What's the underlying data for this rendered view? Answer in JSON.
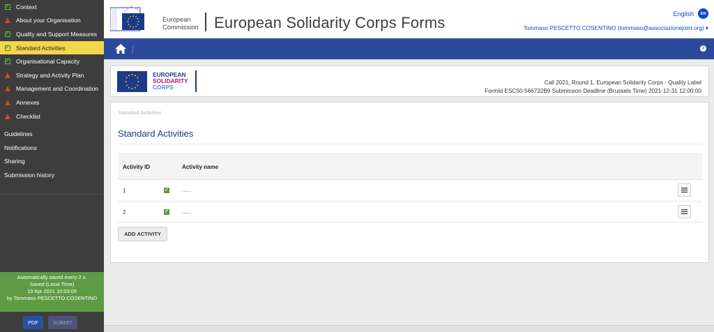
{
  "sidebar": {
    "sections": [
      {
        "label": "Context",
        "status": "check",
        "active": false
      },
      {
        "label": "About your Organisation",
        "status": "warn",
        "active": false
      },
      {
        "label": "Quality and Support Measures",
        "status": "check",
        "active": false
      },
      {
        "label": "Standard Activities",
        "status": "check",
        "active": true
      },
      {
        "label": "Organisational Capacity",
        "status": "check",
        "active": false
      },
      {
        "label": "Strategy and Activity Plan",
        "status": "warn",
        "active": false
      },
      {
        "label": "Management and Coordination",
        "status": "warn",
        "active": false
      },
      {
        "label": "Annexes",
        "status": "warn",
        "active": false
      },
      {
        "label": "Checklist",
        "status": "warn",
        "active": false
      }
    ],
    "links": [
      "Guidelines",
      "Notifications",
      "Sharing",
      "Submission history"
    ],
    "autosave": {
      "line1": "Automatically saved every 2 s.",
      "line2": "Saved (Local Time)",
      "line3": "19 Apr 2021 10:03:09",
      "line4": "by Tommaso PESCETTO COSENTINO"
    },
    "pdf_label": "PDF",
    "submit_label": "SUBMIT"
  },
  "header": {
    "ec_line1": "European",
    "ec_line2": "Commission",
    "title": "European Solidarity Corps Forms",
    "language": "English",
    "language_code": "EN",
    "user": "Tommaso PESCETTO COSENTINO (tommaso@associazionejoint.org) ▾"
  },
  "call": {
    "esc_line1": "EUROPEAN",
    "esc_line2": "SOLIDARITY",
    "esc_line3": "CORPS",
    "line1": "Call 2021,  Round 1,  European Solidarity Corps - Quality Label",
    "line2": "FormId ESC50-566732B9 Submission Deadline (Brussels Time) 2021-12-31 12:00:00"
  },
  "main": {
    "breadcrumb": "Standard Activities",
    "title": "Standard Activities",
    "table": {
      "headers": [
        "Activity ID",
        "Activity name"
      ],
      "rows": [
        {
          "id": "1",
          "name": "......"
        },
        {
          "id": "2",
          "name": "......"
        }
      ]
    },
    "add_label": "ADD ACTIVITY"
  },
  "colors": {
    "sidebar_bg": "#3d3d3d",
    "active_item": "#f3d64b",
    "warning": "#d9412b",
    "success": "#5a9e3a",
    "primary_bar": "#2c4a9a",
    "title_blue": "#1d3a8a"
  },
  "icons": {
    "home": "home-icon",
    "info": "info-icon",
    "row_menu": "hamburger-menu-icon",
    "eu_flag": "eu-flag-icon"
  }
}
